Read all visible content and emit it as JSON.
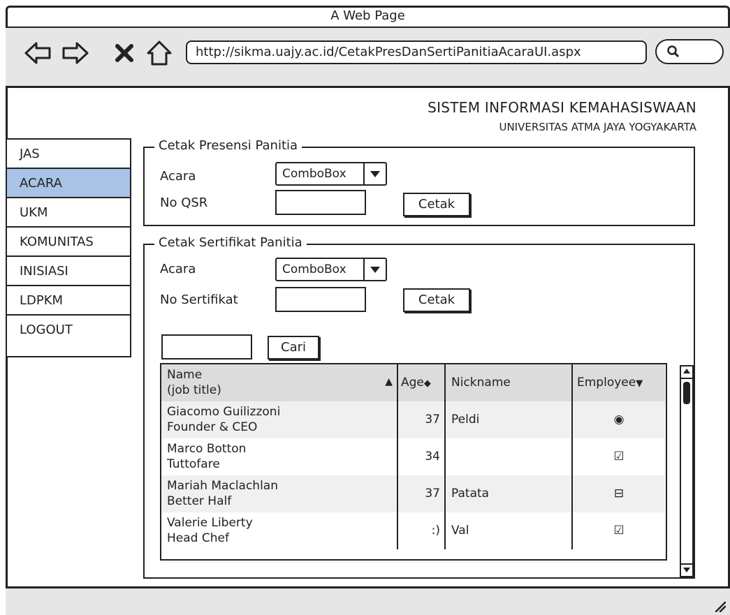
{
  "window": {
    "title": "A Web Page"
  },
  "browser": {
    "url": "http://sikma.uajy.ac.id/CetakPresDanSertiPanitiaAcaraUI.aspx",
    "icons": [
      "back-arrow-icon",
      "forward-arrow-icon",
      "close-x-icon",
      "home-icon",
      "search-icon"
    ]
  },
  "header": {
    "title": "SISTEM INFORMASI KEMAHASISWAAN",
    "subtitle": "UNIVERSITAS ATMA JAYA YOGYAKARTA"
  },
  "sidebar": {
    "items": [
      {
        "label": "JAS"
      },
      {
        "label": "ACARA",
        "active": true
      },
      {
        "label": "UKM"
      },
      {
        "label": "KOMUNITAS"
      },
      {
        "label": "INISIASI"
      },
      {
        "label": "LDPKM"
      },
      {
        "label": "LOGOUT"
      }
    ]
  },
  "presensi": {
    "legend": "Cetak Presensi Panitia",
    "acara_label": "Acara",
    "acara_value": "ComboBox",
    "no_label": "No QSR",
    "no_value": "",
    "button": "Cetak"
  },
  "sertifikat": {
    "legend": "Cetak Sertifikat Panitia",
    "acara_label": "Acara",
    "acara_value": "ComboBox",
    "no_label": "No Sertifikat",
    "no_value": "",
    "button": "Cetak",
    "search_value": "",
    "search_button": "Cari"
  },
  "table": {
    "headers": {
      "name_line1": "Name",
      "name_line2": "(job title)",
      "age": "Age",
      "nickname": "Nickname",
      "employee": "Employee"
    },
    "rows": [
      {
        "name": "Giacomo Guilizzoni",
        "title": "Founder & CEO",
        "age": "37",
        "nickname": "Peldi",
        "employee": "◉"
      },
      {
        "name": "Marco Botton",
        "title": "Tuttofare",
        "age": "34",
        "nickname": "",
        "employee": "☑"
      },
      {
        "name": "Mariah Maclachlan",
        "title": "Better Half",
        "age": "37",
        "nickname": "Patata",
        "employee": "⊟"
      },
      {
        "name": "Valerie Liberty",
        "title": "Head Chef",
        "age": ":)",
        "nickname": "Val",
        "employee": "☑"
      }
    ]
  },
  "colors": {
    "active_item": "#a9c3e6",
    "chrome": "#e6e6e6",
    "table_header": "#dcdcdc"
  }
}
